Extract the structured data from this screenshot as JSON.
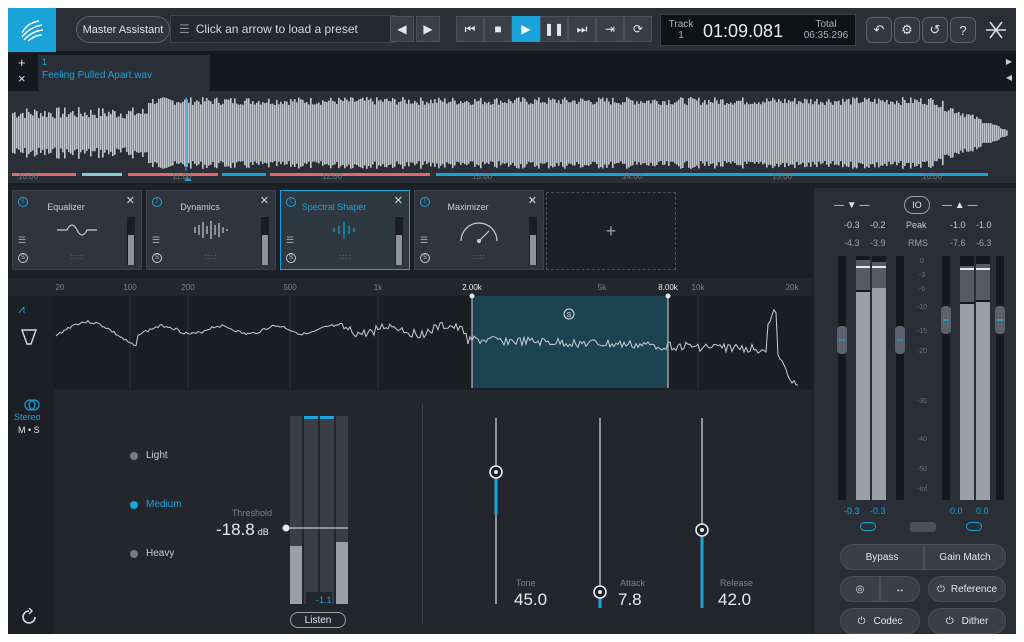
{
  "colors": {
    "accent": "#1aa3d8",
    "panel": "#2a2f37",
    "bg": "#1c2026"
  },
  "topbar": {
    "assistant_label": "Master Assistant",
    "preset_text": "Click an arrow to load a preset",
    "track_label": "Track",
    "track_num": "1",
    "time": "01:09.081",
    "total_label": "Total",
    "total_time": "06:35.296",
    "help_label": "?"
  },
  "tabstrip": {
    "add_label": "+",
    "close_label": "×",
    "tab_num": "1",
    "tab_name": "Feeling Pulled Apart.wav"
  },
  "timeline": {
    "ticks": [
      "10:00",
      "11:00",
      "12:00",
      "13:00",
      "14:00",
      "15:00",
      "16:00"
    ]
  },
  "modules": [
    {
      "name": "Equalizer"
    },
    {
      "name": "Dynamics"
    },
    {
      "name": "Spectral Shaper"
    },
    {
      "name": "Maximizer"
    }
  ],
  "add_module_label": "+",
  "spectrum": {
    "freq_ticks": [
      "20",
      "100",
      "200",
      "500",
      "1k",
      "2.00k",
      "5k",
      "8.00k",
      "10k",
      "20k"
    ],
    "band_low": "2.00k",
    "band_high": "8.00k"
  },
  "spectral": {
    "stereo_label": "Stereo",
    "ms_label": "M • S",
    "modes": [
      "Light",
      "Medium",
      "Heavy"
    ],
    "selected_mode": "Medium",
    "threshold_label": "Threshold",
    "threshold_value": "-18.8",
    "threshold_unit": "dB",
    "gr_value": "-1.1",
    "listen_label": "Listen",
    "tone_label": "Tone",
    "tone_value": "45.0",
    "attack_label": "Attack",
    "attack_value": "7.8",
    "release_label": "Release",
    "release_value": "42.0"
  },
  "meters": {
    "io_label": "IO",
    "peak_label": "Peak",
    "rms_label": "RMS",
    "in_peak": [
      "-0.3",
      "-0.2"
    ],
    "in_rms": [
      "-4.3",
      "-3.9"
    ],
    "out_peak": [
      "-1.0",
      "-1.0"
    ],
    "out_rms": [
      "-7.6",
      "-6.3"
    ],
    "scale": [
      "0",
      "-3",
      "-6",
      "-10",
      "-15",
      "-20",
      "-30",
      "-40",
      "-50",
      "-Inf"
    ],
    "in_bottom": [
      "-0.3",
      "-0.3"
    ],
    "out_bottom": [
      "0.0",
      "0.0"
    ]
  },
  "buttons": {
    "bypass": "Bypass",
    "gain_match": "Gain Match",
    "reference": "Reference",
    "codec": "Codec",
    "dither": "Dither"
  }
}
